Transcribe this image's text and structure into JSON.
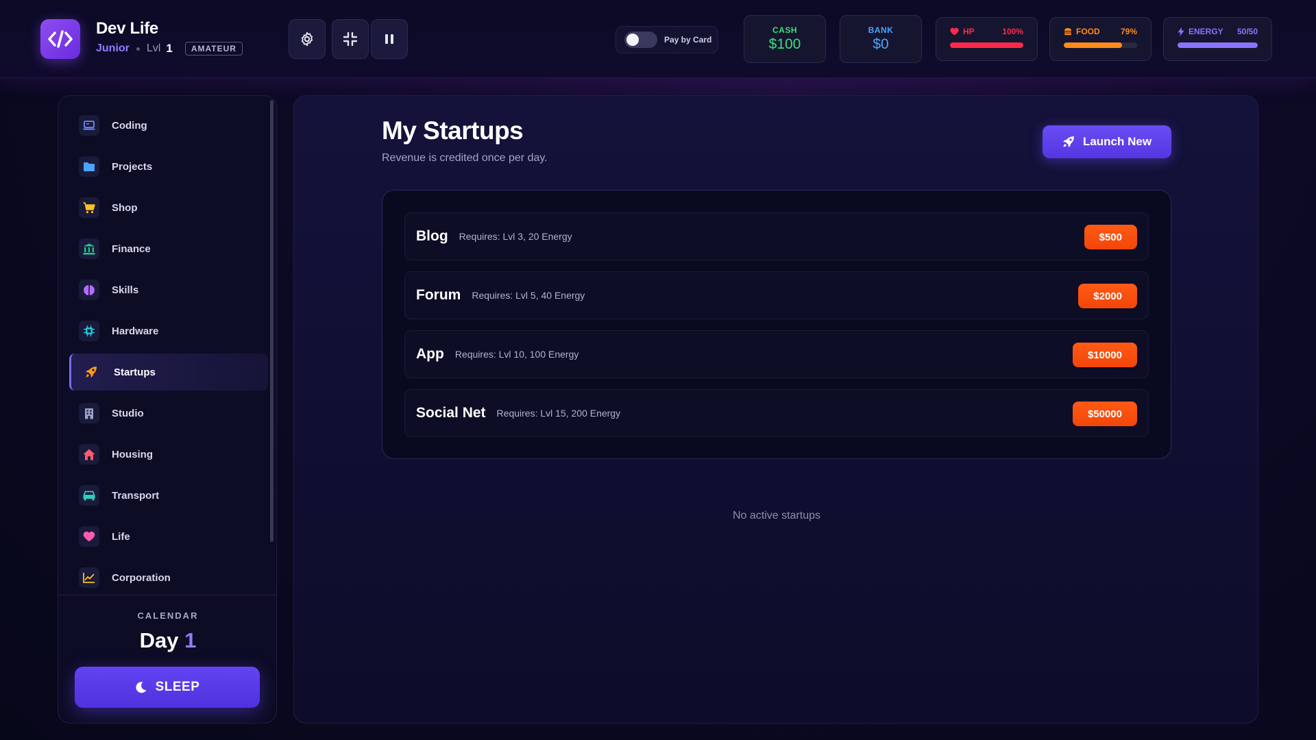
{
  "header": {
    "app_title": "Dev Life",
    "rank": "Junior",
    "level_label": "Lvl",
    "level_value": "1",
    "tier": "AMATEUR",
    "pay_by_card_label": "Pay by Card",
    "pay_by_card_enabled": false,
    "cash": {
      "label": "CASH",
      "value": "$100",
      "color": "#39e07a"
    },
    "bank": {
      "label": "BANK",
      "value": "$0",
      "color": "#4aa3ff"
    },
    "hp": {
      "label": "HP",
      "value": "100%",
      "fraction": 1.0,
      "color": "#ff2a4a"
    },
    "food": {
      "label": "FOOD",
      "value": "79%",
      "fraction": 0.79,
      "color": "#ff8a1a"
    },
    "energy": {
      "label": "ENERGY",
      "value": "50/50",
      "fraction": 1.0,
      "color": "#8a74ff"
    }
  },
  "sidebar": {
    "items": [
      {
        "label": "Coding",
        "icon": "laptop-icon",
        "color": "#6d8cff",
        "active": false
      },
      {
        "label": "Projects",
        "icon": "folder-icon",
        "color": "#4aa3ff",
        "active": false
      },
      {
        "label": "Shop",
        "icon": "cart-icon",
        "color": "#ffc21a",
        "active": false
      },
      {
        "label": "Finance",
        "icon": "bank-icon",
        "color": "#22c98a",
        "active": false
      },
      {
        "label": "Skills",
        "icon": "brain-icon",
        "color": "#b46cff",
        "active": false
      },
      {
        "label": "Hardware",
        "icon": "chip-icon",
        "color": "#22c8d8",
        "active": false
      },
      {
        "label": "Startups",
        "icon": "rocket-icon",
        "color": "#ff9a1a",
        "active": true
      },
      {
        "label": "Studio",
        "icon": "building-icon",
        "color": "#9aa3c8",
        "active": false
      },
      {
        "label": "Housing",
        "icon": "house-icon",
        "color": "#ff5a6e",
        "active": false
      },
      {
        "label": "Transport",
        "icon": "car-icon",
        "color": "#2ed0c0",
        "active": false
      },
      {
        "label": "Life",
        "icon": "heart-icon",
        "color": "#ff5ab4",
        "active": false
      },
      {
        "label": "Corporation",
        "icon": "chart-line-icon",
        "color": "#ffc21a",
        "active": false
      }
    ],
    "calendar": {
      "label": "CALENDAR",
      "day_word": "Day",
      "day_value": "1"
    },
    "sleep_label": "SLEEP"
  },
  "main": {
    "title": "My Startups",
    "subtitle": "Revenue is credited once per day.",
    "launch_label": "Launch New",
    "startups": [
      {
        "name": "Blog",
        "requirement": "Requires: Lvl 3, 20 Energy",
        "price": "$500"
      },
      {
        "name": "Forum",
        "requirement": "Requires: Lvl 5, 40 Energy",
        "price": "$2000"
      },
      {
        "name": "App",
        "requirement": "Requires: Lvl 10, 100 Energy",
        "price": "$10000"
      },
      {
        "name": "Social Net",
        "requirement": "Requires: Lvl 15, 200 Energy",
        "price": "$50000"
      }
    ],
    "empty_text": "No active startups"
  }
}
